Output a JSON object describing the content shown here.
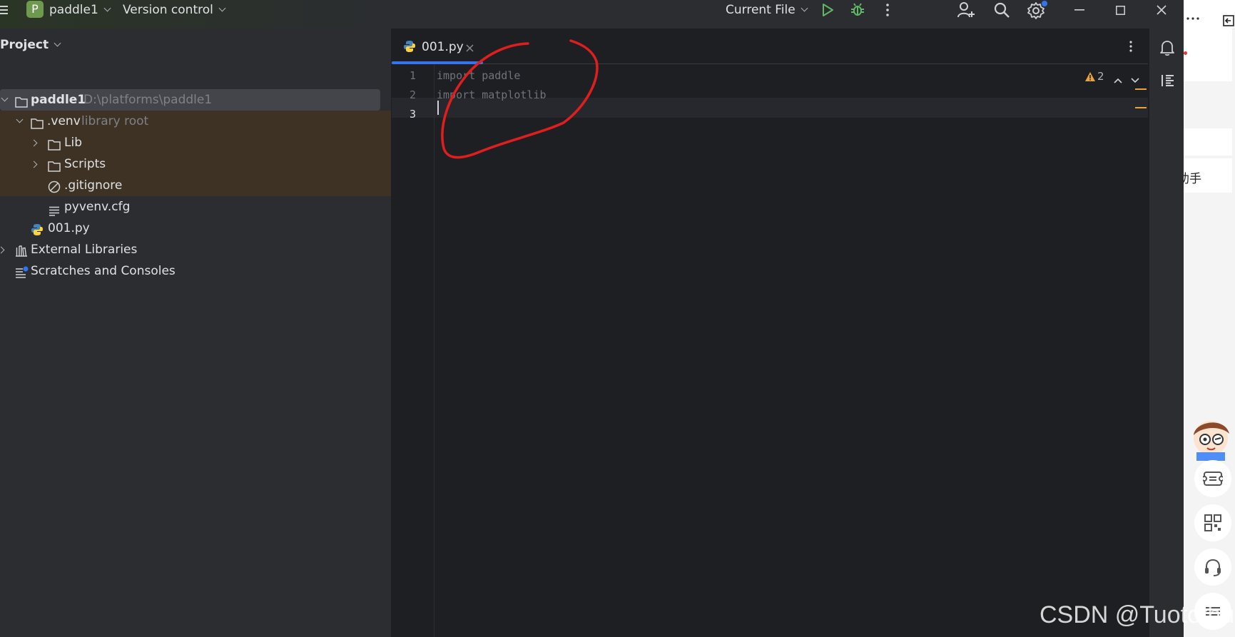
{
  "titlebar": {
    "project_badge": "P",
    "project_name": "paddle1",
    "version_control": "Version control",
    "run_config": "Current File"
  },
  "project_panel": {
    "title": "Project",
    "tree": [
      {
        "label": "paddle1",
        "hint": "D:\\platforms\\paddle1",
        "icon": "folder-icon",
        "expanded": true
      },
      {
        "label": ".venv",
        "hint": "library root",
        "icon": "folder-icon",
        "expanded": true
      },
      {
        "label": "Lib",
        "icon": "folder-icon",
        "expanded": false
      },
      {
        "label": "Scripts",
        "icon": "folder-icon",
        "expanded": false
      },
      {
        "label": ".gitignore",
        "icon": "ignore-file-icon"
      },
      {
        "label": "pyvenv.cfg",
        "icon": "text-file-icon"
      },
      {
        "label": "001.py",
        "icon": "python-file-icon"
      },
      {
        "label": "External Libraries",
        "icon": "library-icon",
        "expanded": false
      },
      {
        "label": "Scratches and Consoles",
        "icon": "scratches-icon"
      }
    ]
  },
  "editor": {
    "tab_label": "001.py",
    "line_numbers": [
      "1",
      "2",
      "3"
    ],
    "lines": [
      "import paddle",
      "import matplotlib",
      ""
    ],
    "warning_count": "2"
  },
  "right_panel": {
    "partial_text": "助手"
  },
  "watermark": "CSDN @Tuotothua",
  "colors": {
    "accent": "#3574f0",
    "venv_highlight": "#3d3223",
    "annotation": "#e01e1e",
    "warning": "#e8a33d"
  }
}
